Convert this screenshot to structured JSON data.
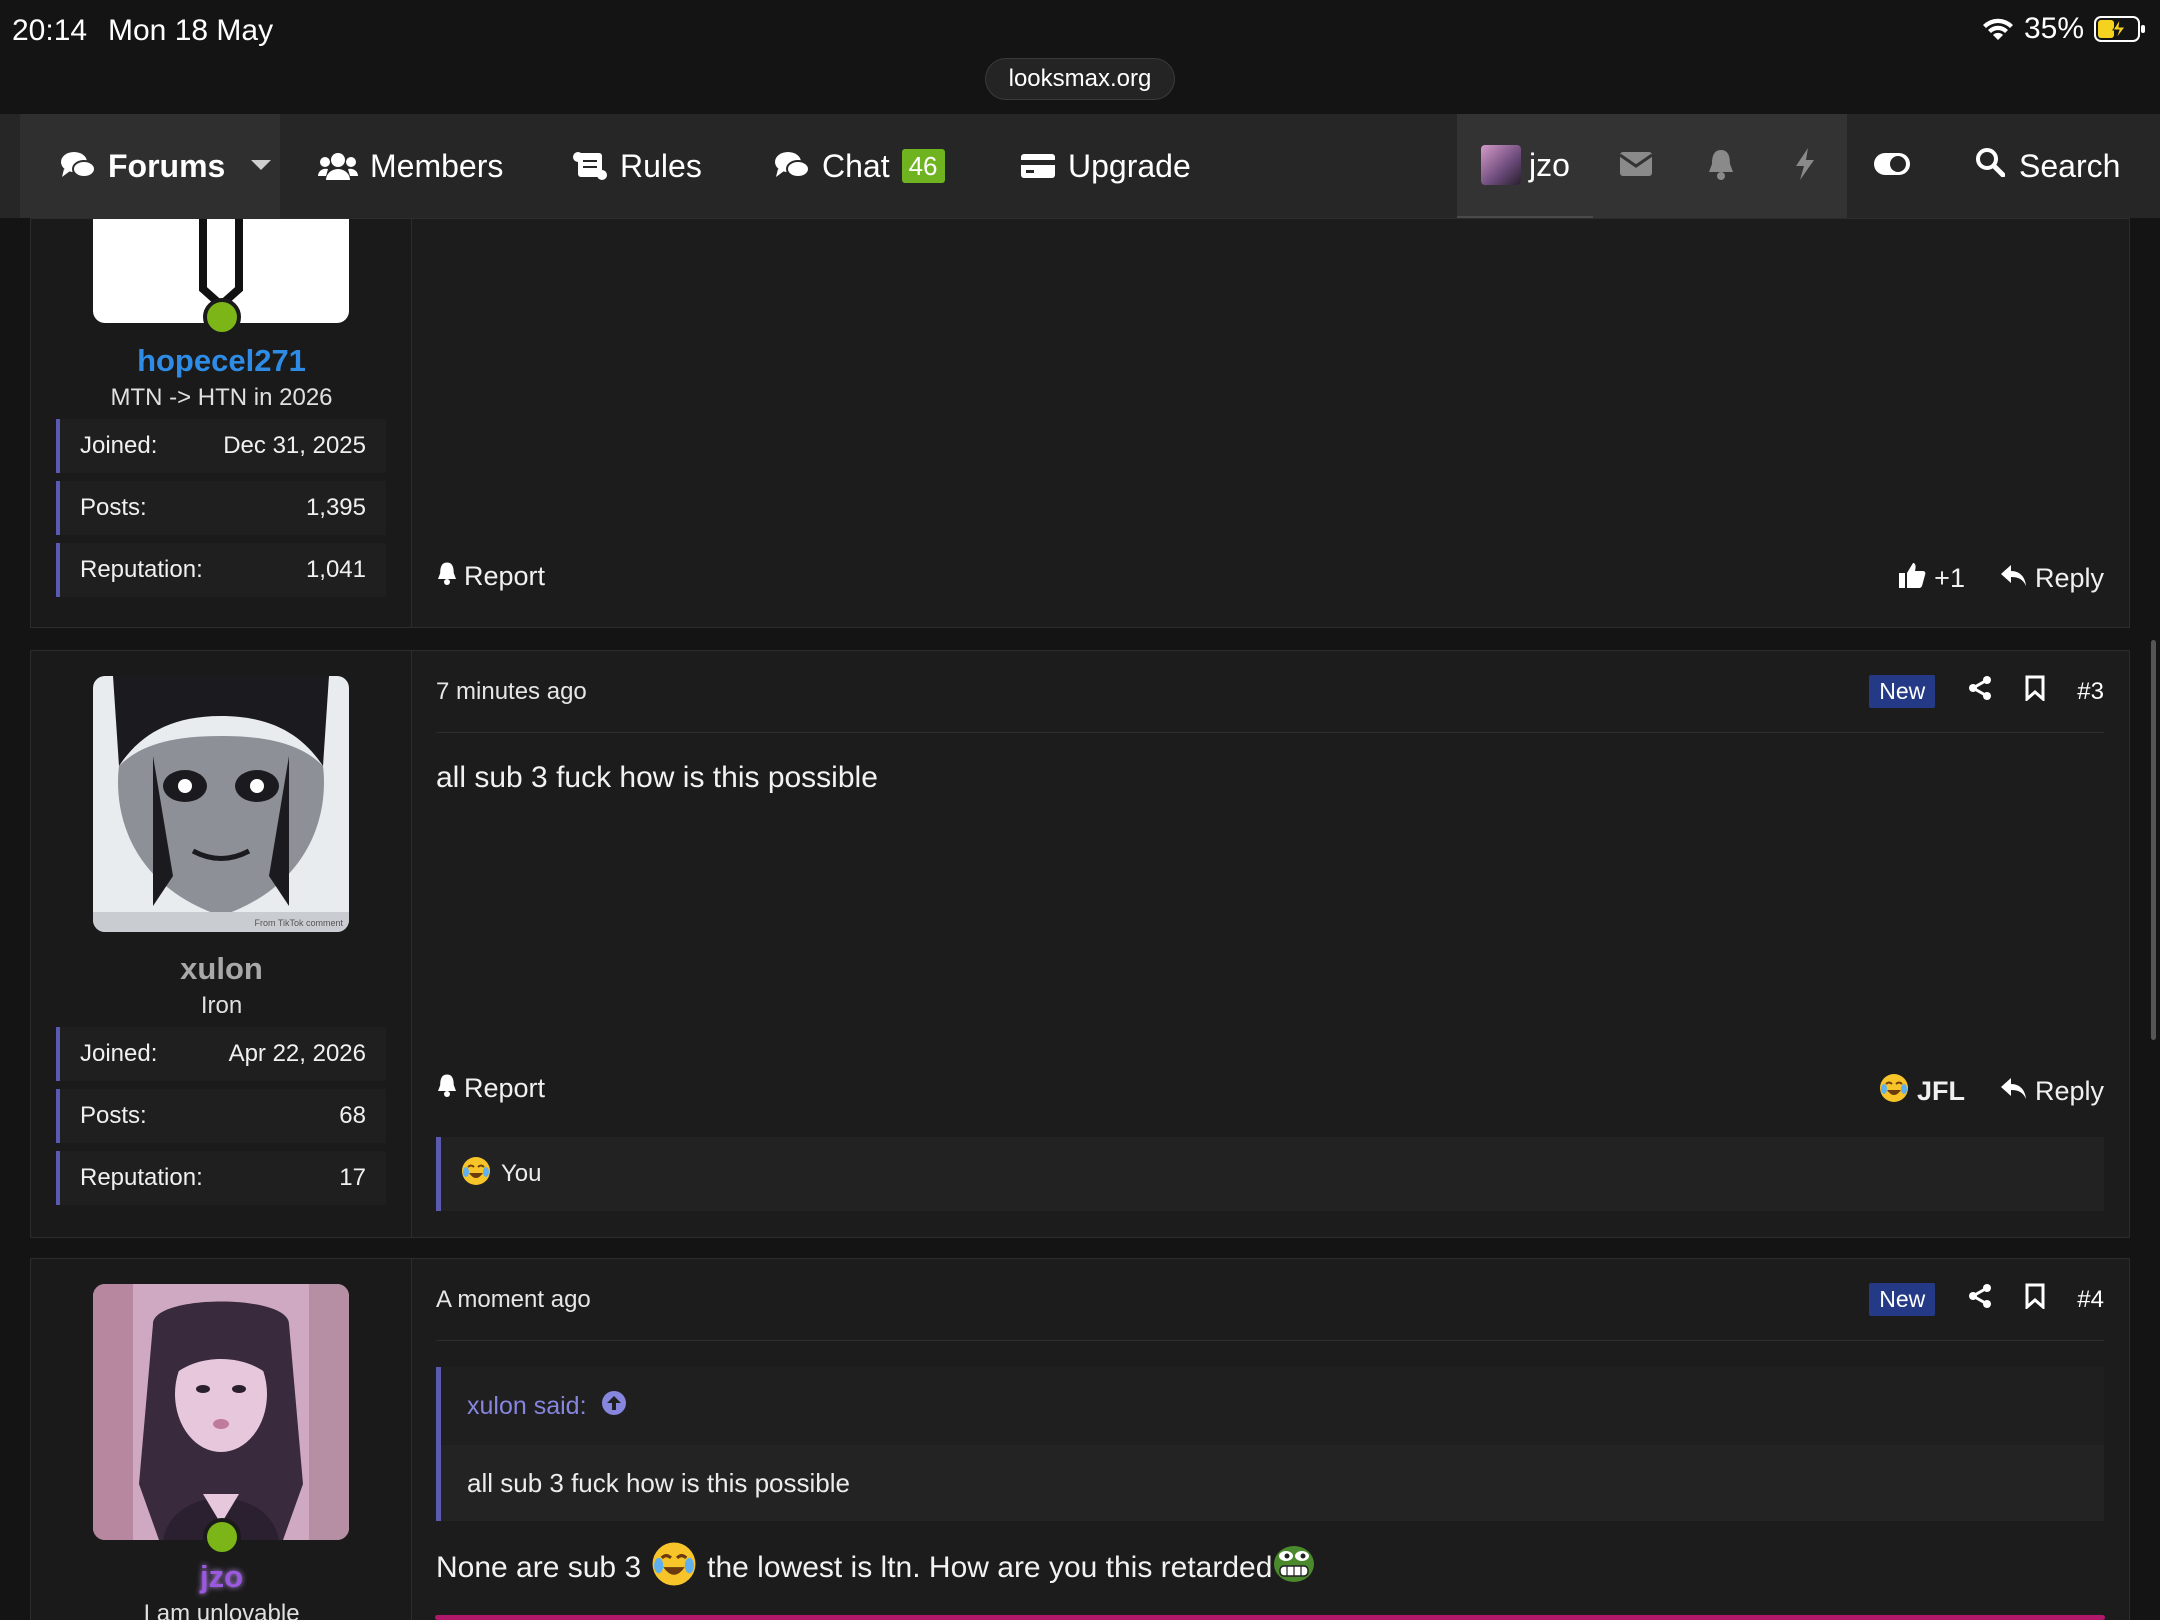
{
  "status_bar": {
    "time": "20:14",
    "date": "Mon 18 May",
    "url": "looksmax.org",
    "battery": "35%"
  },
  "nav": {
    "forums": "Forums",
    "members": "Members",
    "rules": "Rules",
    "chat": "Chat",
    "chat_count": "46",
    "upgrade": "Upgrade",
    "user": "jzo",
    "search": "Search"
  },
  "posts": [
    {
      "username": "hopecel271",
      "user_title": "MTN -> HTN in 2026",
      "stats": [
        {
          "label": "Joined:",
          "value": "Dec 31, 2025"
        },
        {
          "label": "Posts:",
          "value": "1,395"
        },
        {
          "label": "Reputation:",
          "value": "1,041"
        }
      ],
      "report": "Report",
      "reaction": "+1",
      "reply": "Reply"
    },
    {
      "username": "xulon",
      "user_title": "Iron",
      "stats": [
        {
          "label": "Joined:",
          "value": "Apr 22, 2026"
        },
        {
          "label": "Posts:",
          "value": "68"
        },
        {
          "label": "Reputation:",
          "value": "17"
        }
      ],
      "time": "7 minutes ago",
      "new_label": "New",
      "number": "#3",
      "body": "all sub 3 fuck how is this possible",
      "report": "Report",
      "reaction": "JFL",
      "reply": "Reply",
      "reacted_by": "You",
      "avatar_caption": "From TikTok comment"
    },
    {
      "username": "jzo",
      "user_title": "I am unlovable",
      "time": "A moment ago",
      "new_label": "New",
      "number": "#4",
      "quote_author": "xulon said:",
      "quote_text": "all sub 3 fuck how is this possible",
      "body_part1": "None are sub 3",
      "body_part2": "the lowest is ltn. How are you this retarded"
    }
  ],
  "colors": {
    "accent": "#5a5ab0",
    "online": "#7cb518",
    "username_blue": "#2e8ce6",
    "username_gray": "#a8a8a8",
    "username_purple": "#9b59e0",
    "new_badge": "#243a86",
    "chat_badge": "#6fb320"
  }
}
